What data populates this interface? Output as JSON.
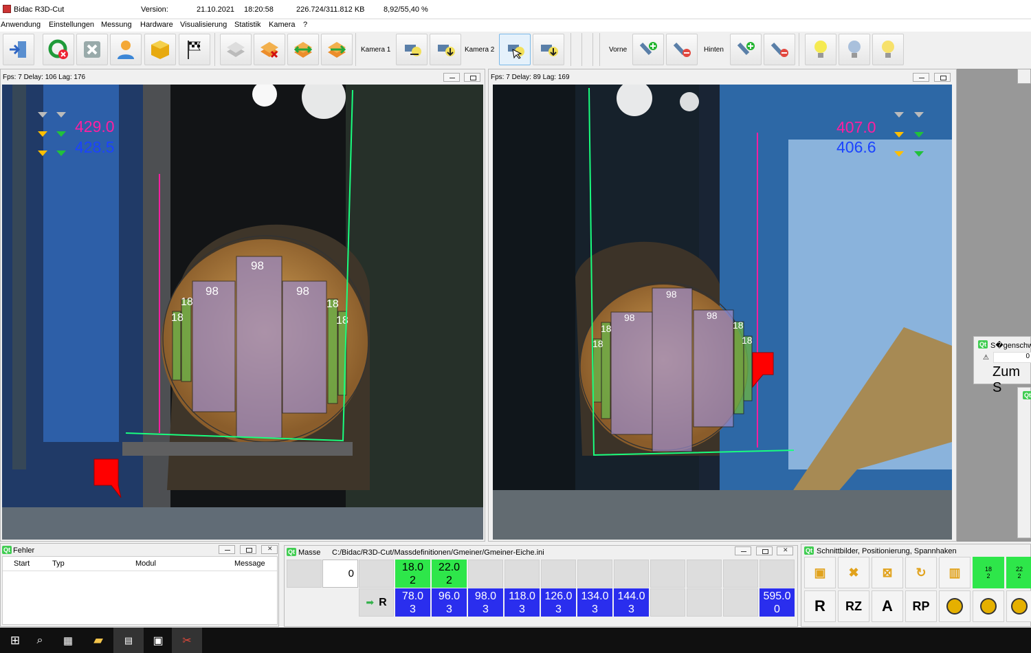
{
  "window": {
    "title": "Bidac R3D-Cut",
    "version_label": "Version:",
    "date": "21.10.2021",
    "time": "18:20:58",
    "memory": "226.724/311.812 KB",
    "stats": "8,92/55,40 %"
  },
  "menu": [
    "Anwendung",
    "Einstellungen",
    "Messung",
    "Hardware",
    "Visualisierung",
    "Statistik",
    "Kamera",
    "?"
  ],
  "toolbar": {
    "kamera1": "Kamera 1",
    "kamera2": "Kamera 2",
    "vorne": "Vorne",
    "hinten": "Hinten",
    "icons": [
      "exit-icon",
      "refresh-cancel-icon",
      "close-x-icon",
      "user-icon",
      "cube-icon",
      "flag-icon",
      "layers-icon",
      "stack-delete-icon",
      "stack-arrows-icon",
      "stack-arrows-alt-icon",
      "camera-light-icon",
      "camera-down-icon",
      "camera-light-active-icon",
      "camera-down-alt-icon",
      "laser-add-icon",
      "laser-remove-icon",
      "laser-add-alt-icon",
      "laser-remove-alt-icon",
      "bulb-on-icon",
      "bulb-off-icon",
      "bulb-dim-icon"
    ]
  },
  "camera_left": {
    "header": "Fps: 7 Delay: 106 Lag: 176",
    "measure1": "429.0",
    "measure2": "428.5",
    "boards": [
      "98",
      "98",
      "98",
      "18",
      "18",
      "18",
      "18"
    ]
  },
  "camera_right": {
    "header": "Fps: 7 Delay: 89 Lag: 169",
    "measure1": "407.0",
    "measure2": "406.6",
    "boards": [
      "98",
      "98",
      "98",
      "18",
      "18",
      "18",
      "18"
    ]
  },
  "fehler": {
    "title": "Fehler",
    "columns": [
      "Start",
      "Typ",
      "Modul",
      "Message"
    ]
  },
  "masse": {
    "title": "Masse",
    "path": "C:/Bidac/R3D-Cut/Massdefinitionen/Gmeiner/Gmeiner-Eiche.ini",
    "input_value": "0",
    "r_label": "R",
    "top_row": [
      {
        "v": "18.0",
        "n": "2"
      },
      {
        "v": "22.0",
        "n": "2"
      }
    ],
    "bottom_row": [
      {
        "v": "78.0",
        "n": "3"
      },
      {
        "v": "96.0",
        "n": "3"
      },
      {
        "v": "98.0",
        "n": "3"
      },
      {
        "v": "118.0",
        "n": "3"
      },
      {
        "v": "126.0",
        "n": "3"
      },
      {
        "v": "134.0",
        "n": "3"
      },
      {
        "v": "144.0",
        "n": "3"
      }
    ],
    "total": {
      "v": "595.0",
      "n": "0"
    }
  },
  "schnitt": {
    "title": "Schnittbilder, Positionierung, Spannhaken",
    "tiles": [
      {
        "v": "18",
        "n": "2"
      },
      {
        "v": "22",
        "n": "2"
      }
    ],
    "buttons": [
      "R",
      "RZ",
      "A",
      "RP"
    ]
  },
  "side_popup": {
    "title": "S�genschw",
    "value": "0",
    "text": "Zum S"
  },
  "colors": {
    "magenta": "#ff1fa0",
    "blue_measure": "#1b43ff",
    "green": "#2ee64a",
    "blue_cell": "#2a2eee"
  }
}
